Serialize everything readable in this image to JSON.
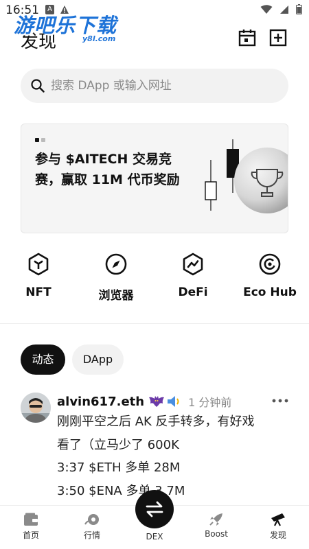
{
  "status_bar": {
    "time": "16:51",
    "notif_letter": "A",
    "warn_glyph": "!"
  },
  "watermark": {
    "main": "游吧乐下载",
    "sub": "y8l.com"
  },
  "header": {
    "title": "发现",
    "calendar_icon": "calendar-icon",
    "add_icon": "plus-square-icon"
  },
  "search": {
    "placeholder": "搜索 DApp 或输入网址",
    "value": ""
  },
  "banner": {
    "text": "参与 $AITECH 交易竞赛，赢取 11M 代币奖励",
    "slides_total": 2,
    "slide_current": 1
  },
  "quick_links": [
    {
      "label": "NFT",
      "icon": "nft-hexagon-icon"
    },
    {
      "label": "浏览器",
      "icon": "compass-icon"
    },
    {
      "label": "DeFi",
      "icon": "defi-chart-icon"
    },
    {
      "label": "Eco Hub",
      "icon": "eco-hub-icon"
    }
  ],
  "feed_tabs": [
    {
      "label": "动态",
      "active": true
    },
    {
      "label": "DApp",
      "active": false
    }
  ],
  "post": {
    "author": "alvin617.eth",
    "time": "1 分钟前",
    "badges": [
      "bat-badge-icon",
      "speaker-icon"
    ],
    "lines": [
      "刚刚平空之后 AK 反手转多，有好戏",
      "看了（立马少了 600K",
      "3:37 $ETH 多单 28M",
      "3:50 $ENA 多单 3.7M"
    ]
  },
  "bottom_nav": [
    {
      "label": "首页",
      "icon": "wallet-icon"
    },
    {
      "label": "行情",
      "icon": "market-icon"
    },
    {
      "label": "DEX",
      "icon": "swap-icon"
    },
    {
      "label": "Boost",
      "icon": "rocket-icon"
    },
    {
      "label": "发现",
      "icon": "telescope-icon",
      "active": true
    }
  ],
  "colors": {
    "accent": "#111111",
    "watermark": "#1e73d8",
    "muted": "#888888"
  }
}
